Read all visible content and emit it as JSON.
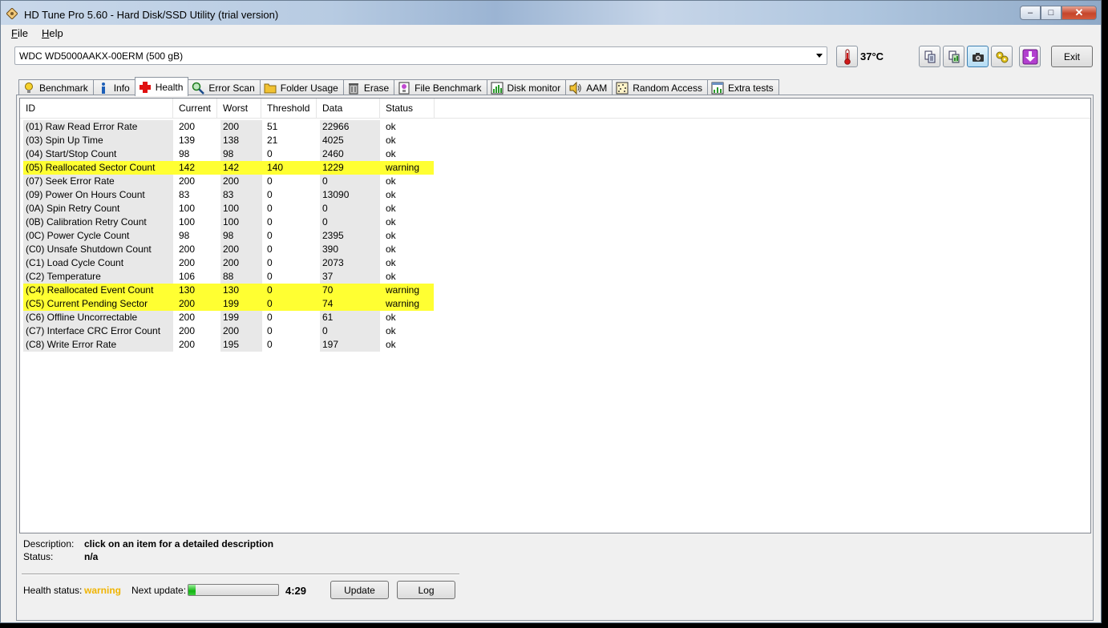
{
  "window": {
    "title": "HD Tune Pro 5.60 - Hard Disk/SSD Utility (trial version)",
    "controls": {
      "minimize": "–",
      "maximize": "□",
      "close": "✕"
    }
  },
  "menu": {
    "items": [
      {
        "label": "File",
        "mnemonic": "F",
        "rest": "ile"
      },
      {
        "label": "Help",
        "mnemonic": "H",
        "rest": "elp"
      }
    ]
  },
  "toolbar": {
    "drive": "WDC WD5000AAKX-00ERM (500 gB)",
    "temperature": "37°C",
    "exit_label": "Exit",
    "icons": [
      "copy-text-icon",
      "copy-image-icon",
      "screenshot-camera-icon",
      "options-tools-icon",
      "save-down-arrow-icon"
    ]
  },
  "tabs": [
    {
      "label": "Benchmark",
      "icon": "benchmark-bulb-icon"
    },
    {
      "label": "Info",
      "icon": "info-icon"
    },
    {
      "label": "Health",
      "icon": "health-cross-icon",
      "active": true
    },
    {
      "label": "Error Scan",
      "icon": "magnifier-icon"
    },
    {
      "label": "Folder Usage",
      "icon": "folder-icon"
    },
    {
      "label": "Erase",
      "icon": "trash-icon"
    },
    {
      "label": "File Benchmark",
      "icon": "file-benchmark-icon"
    },
    {
      "label": "Disk monitor",
      "icon": "disk-monitor-icon"
    },
    {
      "label": "AAM",
      "icon": "speaker-icon"
    },
    {
      "label": "Random Access",
      "icon": "random-access-icon"
    },
    {
      "label": "Extra tests",
      "icon": "extra-tests-icon"
    }
  ],
  "table": {
    "columns": [
      "ID",
      "Current",
      "Worst",
      "Threshold",
      "Data",
      "Status"
    ],
    "rows": [
      {
        "id": "(01) Raw Read Error Rate",
        "current": "200",
        "worst": "200",
        "threshold": "51",
        "data": "22966",
        "status": "ok"
      },
      {
        "id": "(03) Spin Up Time",
        "current": "139",
        "worst": "138",
        "threshold": "21",
        "data": "4025",
        "status": "ok"
      },
      {
        "id": "(04) Start/Stop Count",
        "current": "98",
        "worst": "98",
        "threshold": "0",
        "data": "2460",
        "status": "ok"
      },
      {
        "id": "(05) Reallocated Sector Count",
        "current": "142",
        "worst": "142",
        "threshold": "140",
        "data": "1229",
        "status": "warning"
      },
      {
        "id": "(07) Seek Error Rate",
        "current": "200",
        "worst": "200",
        "threshold": "0",
        "data": "0",
        "status": "ok"
      },
      {
        "id": "(09) Power On Hours Count",
        "current": "83",
        "worst": "83",
        "threshold": "0",
        "data": "13090",
        "status": "ok"
      },
      {
        "id": "(0A) Spin Retry Count",
        "current": "100",
        "worst": "100",
        "threshold": "0",
        "data": "0",
        "status": "ok"
      },
      {
        "id": "(0B) Calibration Retry Count",
        "current": "100",
        "worst": "100",
        "threshold": "0",
        "data": "0",
        "status": "ok"
      },
      {
        "id": "(0C) Power Cycle Count",
        "current": "98",
        "worst": "98",
        "threshold": "0",
        "data": "2395",
        "status": "ok"
      },
      {
        "id": "(C0) Unsafe Shutdown Count",
        "current": "200",
        "worst": "200",
        "threshold": "0",
        "data": "390",
        "status": "ok"
      },
      {
        "id": "(C1) Load Cycle Count",
        "current": "200",
        "worst": "200",
        "threshold": "0",
        "data": "2073",
        "status": "ok"
      },
      {
        "id": "(C2) Temperature",
        "current": "106",
        "worst": "88",
        "threshold": "0",
        "data": "37",
        "status": "ok"
      },
      {
        "id": "(C4) Reallocated Event Count",
        "current": "130",
        "worst": "130",
        "threshold": "0",
        "data": "70",
        "status": "warning"
      },
      {
        "id": "(C5) Current Pending Sector",
        "current": "200",
        "worst": "199",
        "threshold": "0",
        "data": "74",
        "status": "warning"
      },
      {
        "id": "(C6) Offline Uncorrectable",
        "current": "200",
        "worst": "199",
        "threshold": "0",
        "data": "61",
        "status": "ok"
      },
      {
        "id": "(C7) Interface CRC Error Count",
        "current": "200",
        "worst": "200",
        "threshold": "0",
        "data": "0",
        "status": "ok"
      },
      {
        "id": "(C8) Write Error Rate",
        "current": "200",
        "worst": "195",
        "threshold": "0",
        "data": "197",
        "status": "ok"
      }
    ]
  },
  "details": {
    "description_label": "Description:",
    "description_value": "click on an item for a detailed description",
    "status_label": "Status:",
    "status_value": "n/a"
  },
  "health": {
    "label": "Health status:",
    "value": "warning",
    "value_color": "#f0b400",
    "warning_row_color": "#ffff32",
    "next_update_label": "Next update:",
    "progress_fraction": 0.08,
    "countdown": "4:29",
    "update_label": "Update",
    "log_label": "Log"
  }
}
